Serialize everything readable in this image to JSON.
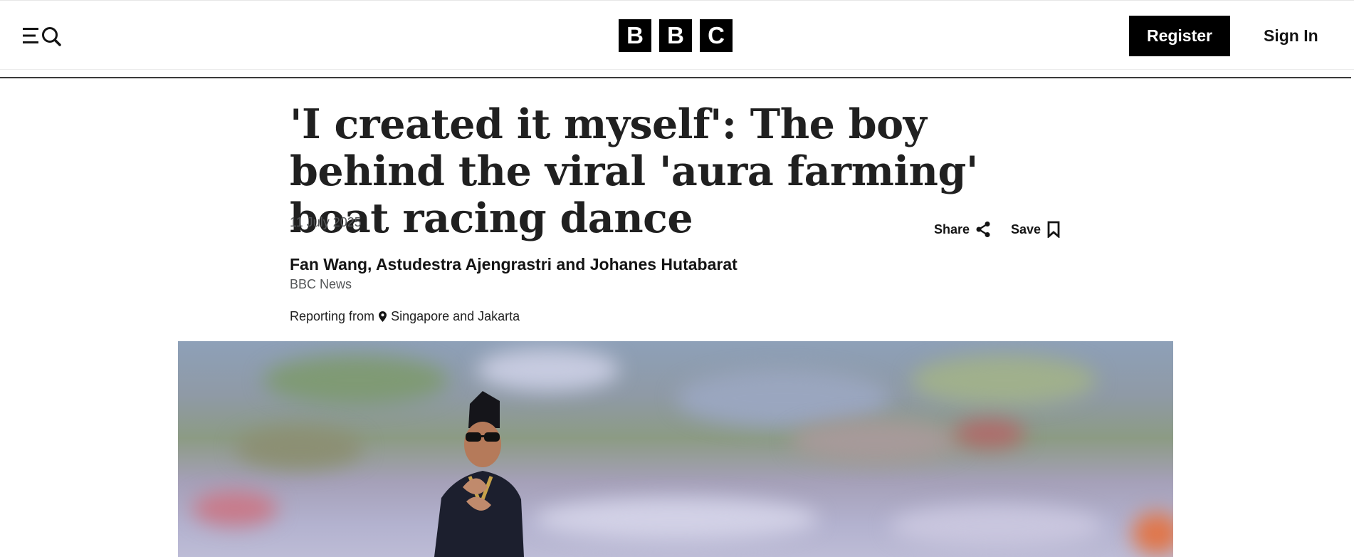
{
  "header": {
    "menu_icon": "menu-lines-icon",
    "search_icon": "search-icon",
    "logo_letters": [
      "B",
      "B",
      "C"
    ],
    "register_label": "Register",
    "signin_label": "Sign In"
  },
  "article": {
    "headline": "'I created it myself': The boy behind the viral 'aura farming' boat racing dance",
    "date": "11 July 2025",
    "share_label": "Share",
    "share_icon": "share-icon",
    "save_label": "Save",
    "save_icon": "bookmark-icon",
    "authors": "Fan Wang, Astudestra Ajengrastri and Johanes Hutabarat",
    "publication": "BBC News",
    "reporting_prefix": "Reporting from",
    "location_icon": "map-pin-icon",
    "reporting_location": "Singapore and Jakarta"
  },
  "colors": {
    "brand_black": "#000000",
    "text": "#141414",
    "muted_text": "#545658"
  }
}
